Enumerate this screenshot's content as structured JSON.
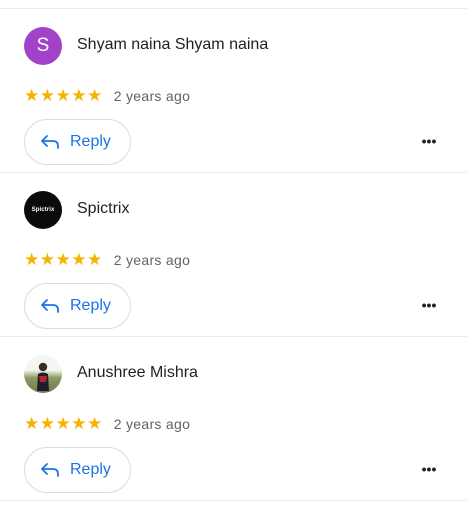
{
  "reviews": [
    {
      "reviewer": "Shyam naina Shyam naina",
      "avatar_letter": "S",
      "stars": "★★★★★",
      "time": "2 years ago",
      "reply_label": "Reply",
      "more_label": "•••"
    },
    {
      "reviewer": "Spictrix",
      "avatar_text": "Spictrix",
      "stars": "★★★★★",
      "time": "2 years ago",
      "reply_label": "Reply",
      "more_label": "•••"
    },
    {
      "reviewer": "Anushree Mishra",
      "stars": "★★★★★",
      "time": "2 years ago",
      "reply_label": "Reply",
      "more_label": "•••"
    }
  ],
  "colors": {
    "accent": "#1a73e8",
    "star": "#f4b400",
    "avatar_s": "#a142c9",
    "divider": "#e8eaed"
  }
}
